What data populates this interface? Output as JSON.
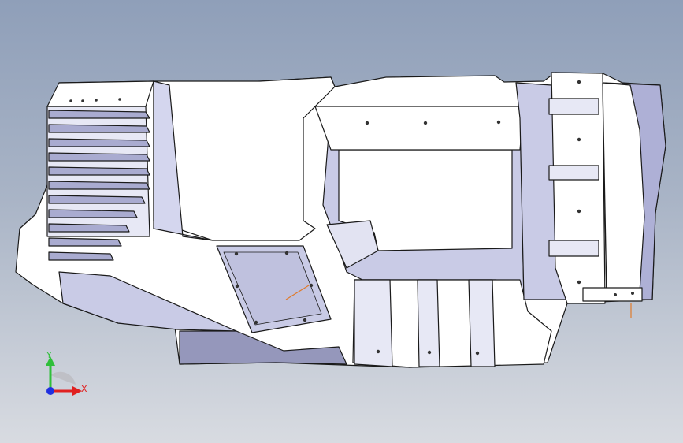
{
  "viewport": {
    "background_top": "#8f9fb9",
    "background_bottom": "#d8dbe1",
    "part_face": "#ffffff",
    "part_shade": "#c9cbe6",
    "part_dark": "#8d8fb4",
    "edge": "#1a1a1a",
    "annotation_color": "#e07a2a"
  },
  "triad": {
    "x_label": "X",
    "y_label": "Y",
    "x_color": "#e02020",
    "y_color": "#2fbf3a",
    "z_color": "#2030e0"
  }
}
